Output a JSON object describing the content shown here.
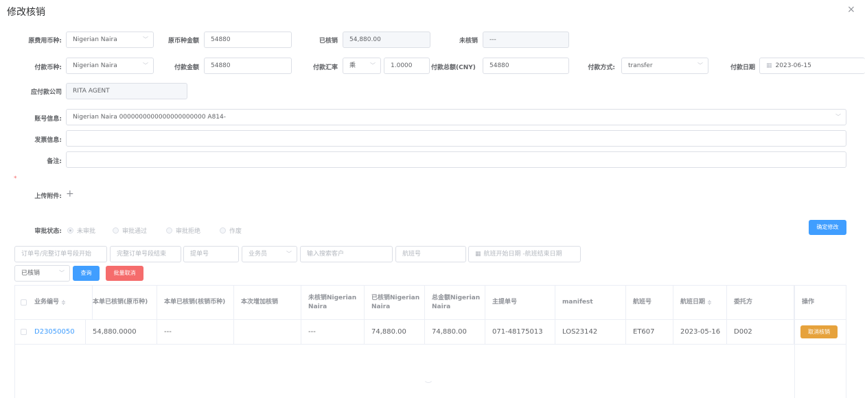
{
  "dialog": {
    "title": "修改核销",
    "close_symbol": "×"
  },
  "form": {
    "orig_currency_label": "原费用币种:",
    "orig_currency_value": "Nigerian Naira",
    "orig_amount_label": "原币种金额",
    "orig_amount_value": "54880",
    "written_off_label": "已核销",
    "written_off_value": "54,880.00",
    "not_written_off_label": "未核销",
    "not_written_off_value": "---",
    "pay_currency_label": "付款币种:",
    "pay_currency_value": "Nigerian Naira",
    "pay_amount_label": "付款金额",
    "pay_amount_value": "54880",
    "pay_rate_label": "付款汇率",
    "pay_rate_op": "乘",
    "pay_rate_value": "1.0000",
    "pay_total_label": "付款总额(CNY)",
    "pay_total_value": "54880",
    "pay_method_label": "付款方式:",
    "pay_method_value": "transfer",
    "pay_date_label": "付款日期",
    "pay_date_value": "2023-06-15",
    "payable_company_label": "应付款公司",
    "payable_company_value": "RITA AGENT",
    "account_label": "账号信息:",
    "account_value": "Nigerian Naira 0000000000000000000000 A814-",
    "invoice_label": "发票信息:",
    "invoice_value": "",
    "remark_label": "备注:",
    "remark_value": "",
    "required_mark": "*",
    "attachment_label": "上传附件:",
    "attachment_add": "+",
    "approval_label": "审批状态:",
    "approval_options": [
      "未审批",
      "审批通过",
      "审批拒绝",
      "作废"
    ],
    "confirm_button": "确定修改"
  },
  "filters": {
    "order_no_placeholder": "订单号/完整订单号段开始",
    "full_order_placeholder": "完整订单号段结束",
    "bill_no_placeholder": "提单号",
    "salesman_placeholder": "业务员",
    "customer_placeholder": "输入搜索客户",
    "flight_placeholder": "航班号",
    "date_range_placeholder": "航班开始日期 -航班结束日期",
    "status_value": "已核销",
    "query_button": "查询",
    "batch_cancel_button": "批量取消"
  },
  "table": {
    "headers": [
      "业务编号",
      "本单已核销(原币种)",
      "本单已核销(核销币种)",
      "本次增加核销",
      "未核销Nigerian Naira",
      "已核销Nigerian Naira",
      "总金额Nigerian Naira",
      "主提单号",
      "manifest",
      "航班号",
      "航班日期",
      "委托方",
      "操作"
    ],
    "rows": [
      [
        "D23050050",
        "54,880.0000",
        "---",
        "",
        "---",
        "74,880.00",
        "74,880.00",
        "071-48175013",
        "LOS23142",
        "ET607",
        "2023-05-16",
        "D002",
        "取消核销"
      ]
    ]
  },
  "icons": {
    "calendar": "calendar-icon",
    "chevron": "chevron-down-icon",
    "sort": "sort-icon"
  }
}
